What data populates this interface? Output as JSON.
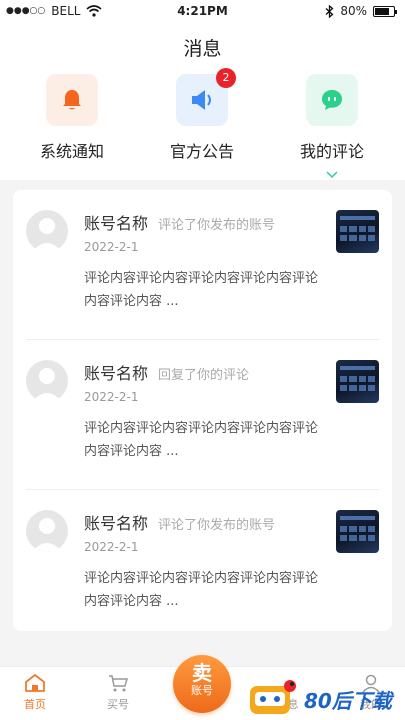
{
  "status_bar": {
    "carrier": "BELL",
    "time": "4:21PM",
    "battery": "80%"
  },
  "page_title": "消息",
  "categories": [
    {
      "label": "系统通知",
      "icon": "bell-icon",
      "color": "#f4661e",
      "bg": "#fdeee5"
    },
    {
      "label": "官方公告",
      "icon": "speaker-icon",
      "color": "#3d8bf2",
      "bg": "#e7f1fd",
      "badge": "2"
    },
    {
      "label": "我的评论",
      "icon": "chat-bubble-icon",
      "color": "#2bd08a",
      "bg": "#e5f8ef"
    }
  ],
  "comments": [
    {
      "name": "账号名称",
      "action": "评论了你发布的账号",
      "date": "2022-2-1",
      "content": "评论内容评论内容评论内容评论内容评论内容评论内容 ..."
    },
    {
      "name": "账号名称",
      "action": "回复了你的评论",
      "date": "2022-2-1",
      "content": "评论内容评论内容评论内容评论内容评论内容评论内容 ..."
    },
    {
      "name": "账号名称",
      "action": "评论了你发布的账号",
      "date": "2022-2-1",
      "content": "评论内容评论内容评论内容评论内容评论内容评论内容 ..."
    }
  ],
  "tabbar": {
    "home": "首页",
    "buy": "买号",
    "sell_big": "卖",
    "sell_small": "账号",
    "message_partial": "息",
    "mine_partial": "我的"
  },
  "watermark": "80后下载",
  "accent": "#f07a2a"
}
